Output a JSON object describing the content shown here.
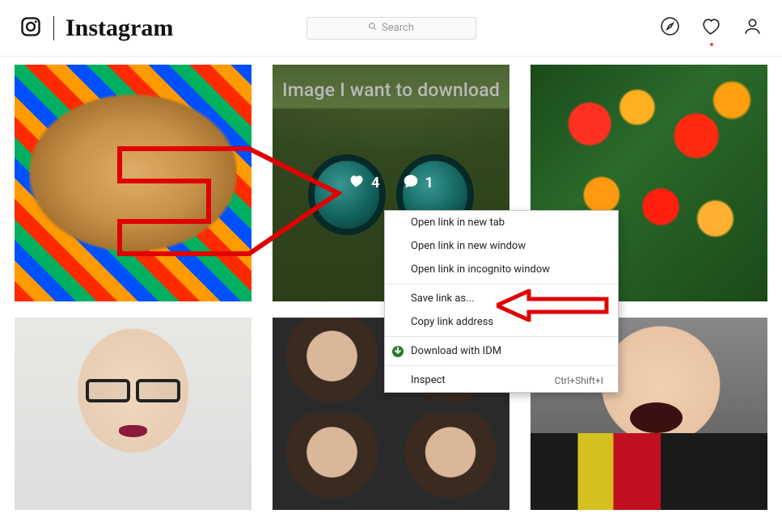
{
  "header": {
    "wordmark": "Instagram",
    "search_placeholder": "Search"
  },
  "posts": {
    "sunglasses": {
      "annotation": "Image I want to download",
      "likes": "4",
      "comments": "1"
    }
  },
  "context_menu": {
    "open_new_tab": "Open link in new tab",
    "open_new_window": "Open link in new window",
    "open_incognito": "Open link in incognito window",
    "save_link_as": "Save link as...",
    "copy_link_address": "Copy link address",
    "download_idm": "Download with IDM",
    "inspect": "Inspect",
    "inspect_shortcut": "Ctrl+Shift+I"
  }
}
